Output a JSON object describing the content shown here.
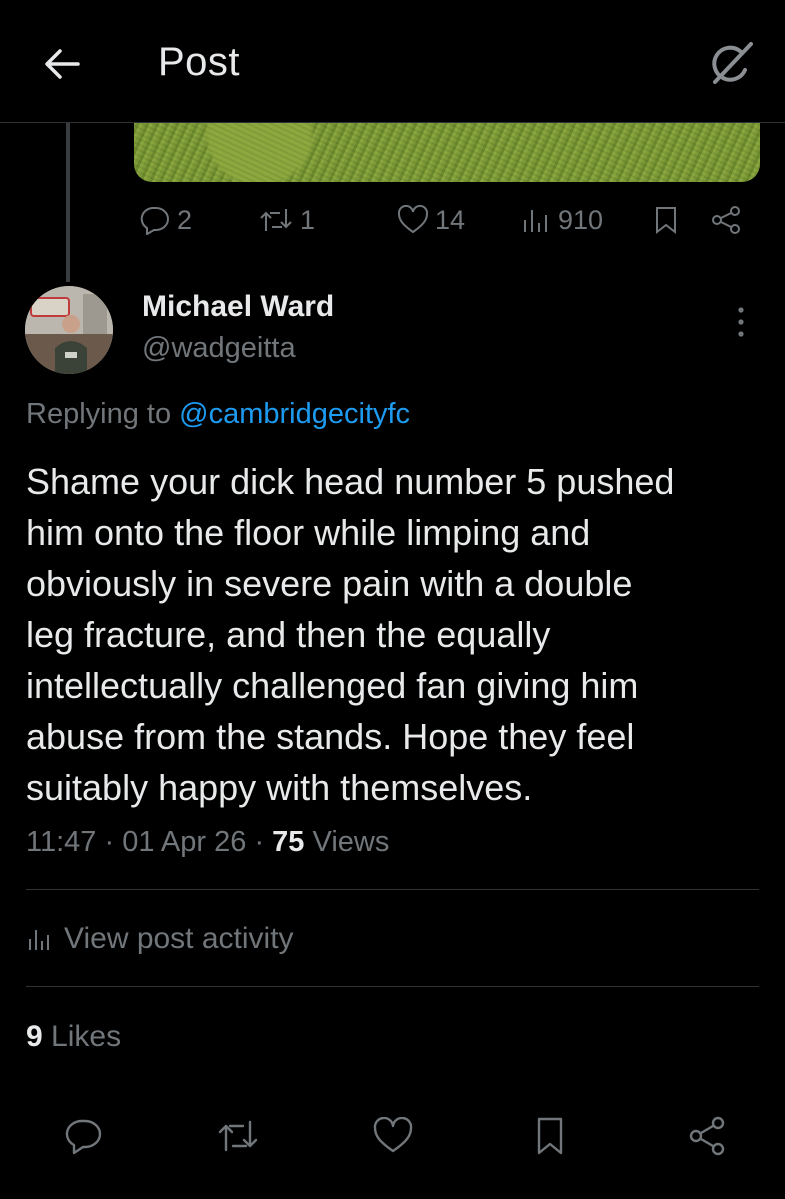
{
  "header": {
    "title": "Post",
    "back_icon": "arrow-left-icon",
    "grok_icon": "grok-icon"
  },
  "prev_post": {
    "actions": {
      "replies": "2",
      "reposts": "1",
      "likes": "14",
      "views": "910"
    }
  },
  "reply": {
    "author_name": "Michael Ward",
    "author_handle": "@wadgeitta",
    "replying_prefix": "Replying to",
    "replying_handle": "@cambridgecityfc",
    "text": "Shame your dick head number 5 pushed\nhim onto the floor while limping and\nobviously in severe pain with a double\nleg fracture, and then the equally\nintellectually challenged fan giving him\nabuse from the stands. Hope they feel\nsuitably happy with themselves.",
    "time": "11:47",
    "sep": "·",
    "date": "01 Apr 26",
    "views_count": "75",
    "views_label": "Views",
    "activity_label": "View post activity",
    "likes_count": "9",
    "likes_label": "Likes"
  },
  "colors": {
    "background": "#000000",
    "text": "#e7e9ea",
    "muted": "#71767b",
    "link": "#1d9bf0",
    "divider": "#2f3336"
  }
}
